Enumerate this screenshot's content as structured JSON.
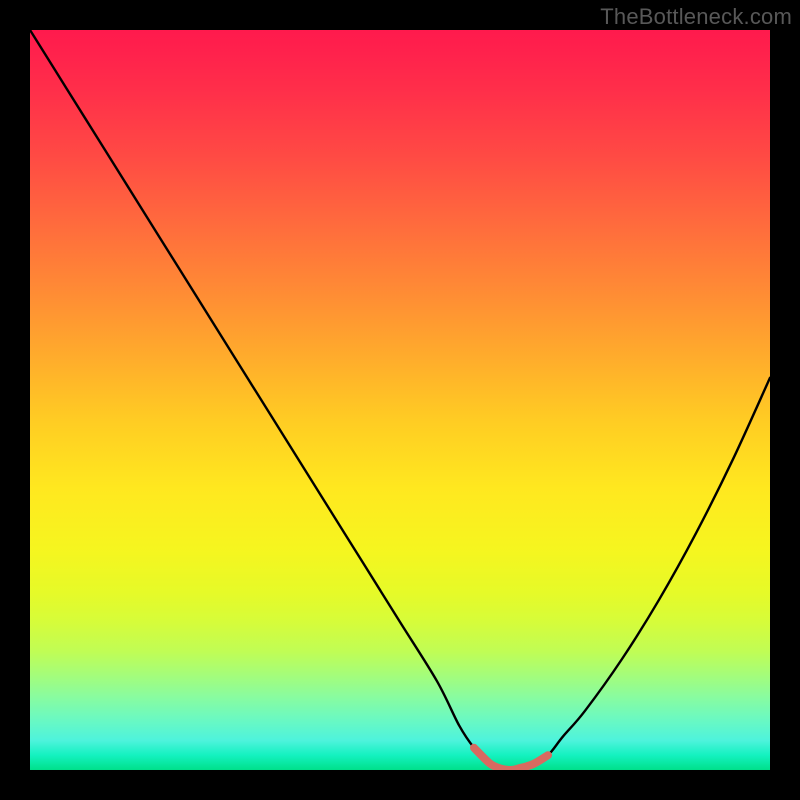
{
  "watermark": "TheBottleneck.com",
  "colors": {
    "curve_stroke": "#000000",
    "valley_stroke": "#d86a60",
    "background": "#000000"
  },
  "chart_data": {
    "type": "line",
    "title": "",
    "xlabel": "",
    "ylabel": "",
    "xlim": [
      0,
      100
    ],
    "ylim": [
      0,
      100
    ],
    "grid": false,
    "axes_visible": false,
    "x": [
      0,
      5,
      10,
      15,
      20,
      25,
      30,
      35,
      40,
      45,
      50,
      55,
      58,
      60,
      62,
      63,
      64,
      65,
      66,
      68,
      70,
      72,
      75,
      80,
      85,
      90,
      95,
      100
    ],
    "values": [
      100,
      92,
      84,
      76,
      68,
      60,
      52,
      44,
      36,
      28,
      20,
      12,
      6,
      3,
      1,
      0.4,
      0.1,
      0,
      0.2,
      0.8,
      2,
      4.5,
      8,
      15,
      23,
      32,
      42,
      53
    ],
    "valley_x_range": [
      60,
      70
    ],
    "series": [
      {
        "name": "bottleneck-curve",
        "color": "#000000"
      }
    ],
    "annotations": [
      {
        "type": "highlight",
        "name": "valley-floor",
        "color": "#d86a60",
        "x_range": [
          60,
          70
        ]
      }
    ]
  }
}
